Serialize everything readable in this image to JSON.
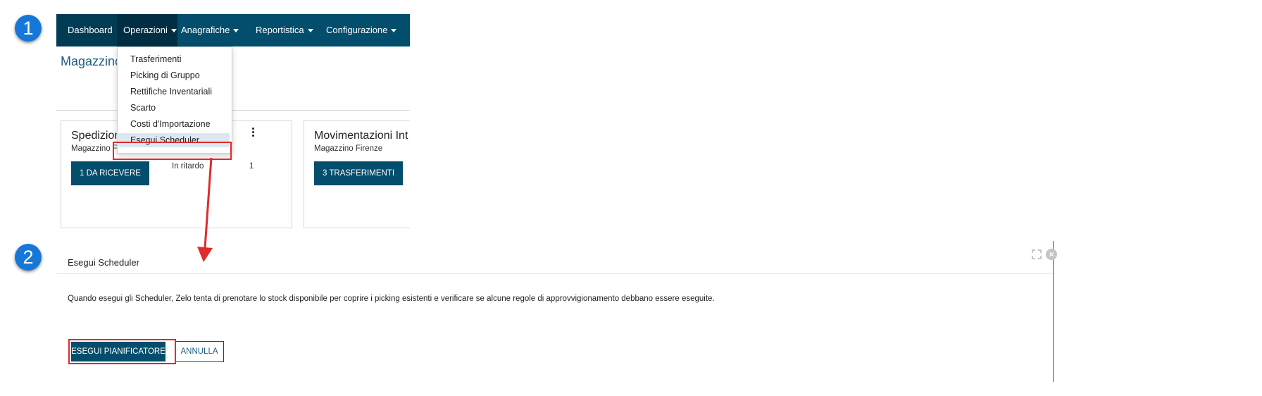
{
  "steps": {
    "step1": "1",
    "step2": "2"
  },
  "navbar": {
    "items": [
      {
        "label": "Dashboard"
      },
      {
        "label": "Operazioni"
      },
      {
        "label": "Anagrafiche"
      },
      {
        "label": "Reportistica"
      },
      {
        "label": "Configurazione"
      }
    ]
  },
  "page": {
    "title": "Magazzino"
  },
  "dropdown": {
    "items": [
      {
        "label": "Trasferimenti"
      },
      {
        "label": "Picking di Gruppo"
      },
      {
        "label": "Rettifiche Inventariali"
      },
      {
        "label": "Scarto"
      },
      {
        "label": "Costi d'Importazione"
      },
      {
        "label": "Esegui Scheduler"
      }
    ]
  },
  "cards": [
    {
      "title": "Spedizioni",
      "subtitle": "Magazzino F",
      "button": "1 DA RICEVERE",
      "late_label": "In ritardo",
      "late_count": "1"
    },
    {
      "title": "Movimentazioni Int",
      "subtitle": "Magazzino Firenze",
      "button": "3 TRASFERIMENTI"
    }
  ],
  "dialog": {
    "title": "Esegui Scheduler",
    "body": "Quando esegui gli Scheduler, Zelo tenta di prenotare lo stock disponibile per coprire i picking esistenti e verificare se alcune regole di approvvigionamento debbano essere eseguite.",
    "primary_button": "ESEGUI PIANIFICATORE",
    "secondary_button": "ANNULLA",
    "close_glyph": "×"
  },
  "colors": {
    "navbar": "#034e6c",
    "accent_blue": "#1677d8",
    "highlight_red": "#e02b2b"
  }
}
